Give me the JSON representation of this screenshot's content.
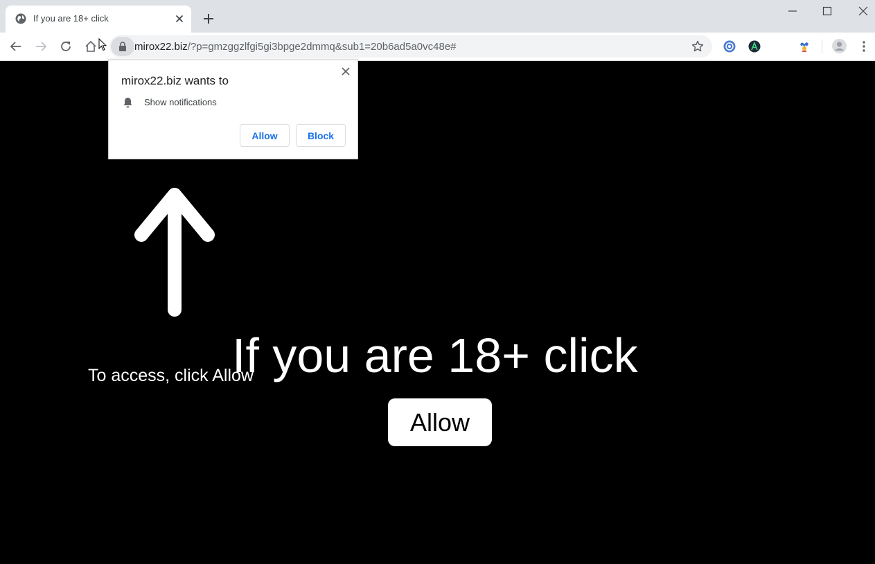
{
  "browser": {
    "tab": {
      "title": "If you are 18+ click",
      "favicon": "globe-icon"
    },
    "url": {
      "domain": "mirox22.biz",
      "path": "/?p=gmzggzlfgi5gi3bpge2dmmq&sub1=20b6ad5a0vc48e#"
    },
    "extensions": [
      "blue-circle-extension-icon",
      "dark-a-extension-icon",
      "jester-extension-icon"
    ]
  },
  "permission_popup": {
    "title": "mirox22.biz wants to",
    "item": "Show notifications",
    "allow_label": "Allow",
    "block_label": "Block"
  },
  "page": {
    "access_text": "To access, click Allow",
    "headline": "If you are 18+ click",
    "allow_button": "Allow"
  },
  "colors": {
    "page_background": "#000000",
    "popup_button_text": "#1a73e8",
    "tabstrip": "#dee1e6"
  }
}
